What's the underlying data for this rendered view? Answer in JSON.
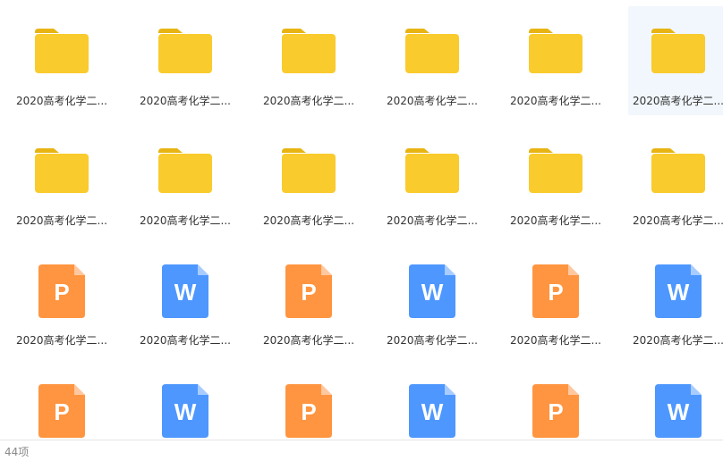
{
  "items": [
    {
      "type": "folder",
      "label": "2020高考化学二..."
    },
    {
      "type": "folder",
      "label": "2020高考化学二..."
    },
    {
      "type": "folder",
      "label": "2020高考化学二..."
    },
    {
      "type": "folder",
      "label": "2020高考化学二..."
    },
    {
      "type": "folder",
      "label": "2020高考化学二..."
    },
    {
      "type": "folder",
      "label": "2020高考化学二...",
      "selected": true
    },
    {
      "type": "folder",
      "label": "2020高考化学二..."
    },
    {
      "type": "folder",
      "label": "2020高考化学二..."
    },
    {
      "type": "folder",
      "label": "2020高考化学二..."
    },
    {
      "type": "folder",
      "label": "2020高考化学二..."
    },
    {
      "type": "folder",
      "label": "2020高考化学二..."
    },
    {
      "type": "folder",
      "label": "2020高考化学二..."
    },
    {
      "type": "ppt",
      "glyph": "P",
      "label": "2020高考化学二..."
    },
    {
      "type": "word",
      "glyph": "W",
      "label": "2020高考化学二..."
    },
    {
      "type": "ppt",
      "glyph": "P",
      "label": "2020高考化学二..."
    },
    {
      "type": "word",
      "glyph": "W",
      "label": "2020高考化学二..."
    },
    {
      "type": "ppt",
      "glyph": "P",
      "label": "2020高考化学二..."
    },
    {
      "type": "word",
      "glyph": "W",
      "label": "2020高考化学二..."
    },
    {
      "type": "ppt",
      "glyph": "P",
      "label": ""
    },
    {
      "type": "word",
      "glyph": "W",
      "label": ""
    },
    {
      "type": "ppt",
      "glyph": "P",
      "label": ""
    },
    {
      "type": "word",
      "glyph": "W",
      "label": ""
    },
    {
      "type": "ppt",
      "glyph": "P",
      "label": ""
    },
    {
      "type": "word",
      "glyph": "W",
      "label": ""
    }
  ],
  "icons": {
    "folder": "folder-icon",
    "ppt": "powerpoint-file-icon",
    "word": "word-file-icon"
  },
  "colors": {
    "folder_body": "#F9CB2D",
    "folder_tab": "#E8B413",
    "ppt": "#FF9540",
    "ppt_fold": "#FFC8A0",
    "word": "#4D97FF",
    "word_fold": "#A9CCFF",
    "selected_bg": "#F1F7FC"
  },
  "status": {
    "count": "44项"
  }
}
